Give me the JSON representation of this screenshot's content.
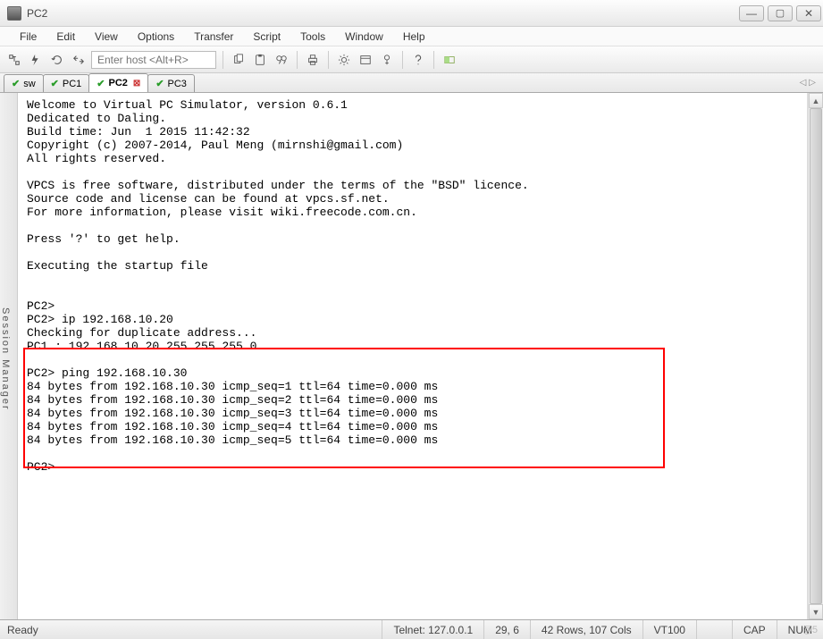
{
  "window": {
    "title": "PC2"
  },
  "menu": {
    "file": "File",
    "edit": "Edit",
    "view": "View",
    "options": "Options",
    "transfer": "Transfer",
    "script": "Script",
    "tools": "Tools",
    "window": "Window",
    "help": "Help"
  },
  "toolbar": {
    "host_placeholder": "Enter host <Alt+R>"
  },
  "tabs": {
    "items": [
      {
        "label": "sw"
      },
      {
        "label": "PC1"
      },
      {
        "label": "PC2"
      },
      {
        "label": "PC3"
      }
    ]
  },
  "sidebar": {
    "label": "Session Manager"
  },
  "terminal": {
    "text": "Welcome to Virtual PC Simulator, version 0.6.1\nDedicated to Daling.\nBuild time: Jun  1 2015 11:42:32\nCopyright (c) 2007-2014, Paul Meng (mirnshi@gmail.com)\nAll rights reserved.\n\nVPCS is free software, distributed under the terms of the \"BSD\" licence.\nSource code and license can be found at vpcs.sf.net.\nFor more information, please visit wiki.freecode.com.cn.\n\nPress '?' to get help.\n\nExecuting the startup file\n\n\nPC2>\nPC2> ip 192.168.10.20\nChecking for duplicate address...\nPC1 : 192.168.10.20 255.255.255.0\n\nPC2> ping 192.168.10.30\n84 bytes from 192.168.10.30 icmp_seq=1 ttl=64 time=0.000 ms\n84 bytes from 192.168.10.30 icmp_seq=2 ttl=64 time=0.000 ms\n84 bytes from 192.168.10.30 icmp_seq=3 ttl=64 time=0.000 ms\n84 bytes from 192.168.10.30 icmp_seq=4 ttl=64 time=0.000 ms\n84 bytes from 192.168.10.30 icmp_seq=5 ttl=64 time=0.000 ms\n\nPC2>"
  },
  "status": {
    "ready": "Ready",
    "connection": "Telnet: 127.0.0.1",
    "cursor": "29,   6",
    "size": "42 Rows, 107 Cols",
    "emulation": "VT100",
    "caps": "CAP",
    "num": "NUM"
  },
  "watermark": "@5"
}
